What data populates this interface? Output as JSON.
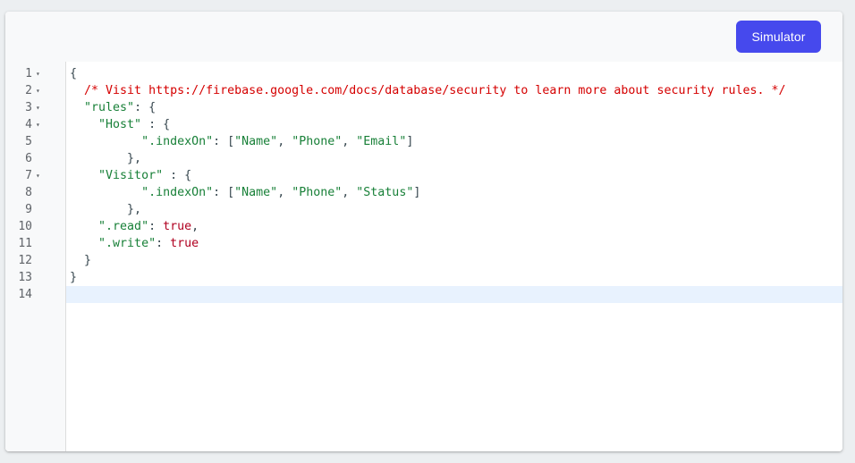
{
  "toolbar": {
    "simulator_label": "Simulator",
    "simulator_color": "#4649ed"
  },
  "editor": {
    "line_numbers": [
      "1",
      "2",
      "3",
      "4",
      "5",
      "6",
      "7",
      "8",
      "9",
      "10",
      "11",
      "12",
      "13",
      "14"
    ],
    "fold_icon": "▾",
    "tokens": {
      "open_brace": "{",
      "comment": "/* Visit https://firebase.google.com/docs/database/security to learn more about security rules. */",
      "rules_key": "\"rules\"",
      "host_key": "\"Host\"",
      "index_on_key": "\".indexOn\"",
      "name": "\"Name\"",
      "phone": "\"Phone\"",
      "email": "\"Email\"",
      "visitor_key": "\"Visitor\"",
      "status": "\"Status\"",
      "read_key": "\".read\"",
      "write_key": "\".write\"",
      "true_value": "true",
      "close_brace": "}",
      "close_brace_comma": "},"
    }
  }
}
